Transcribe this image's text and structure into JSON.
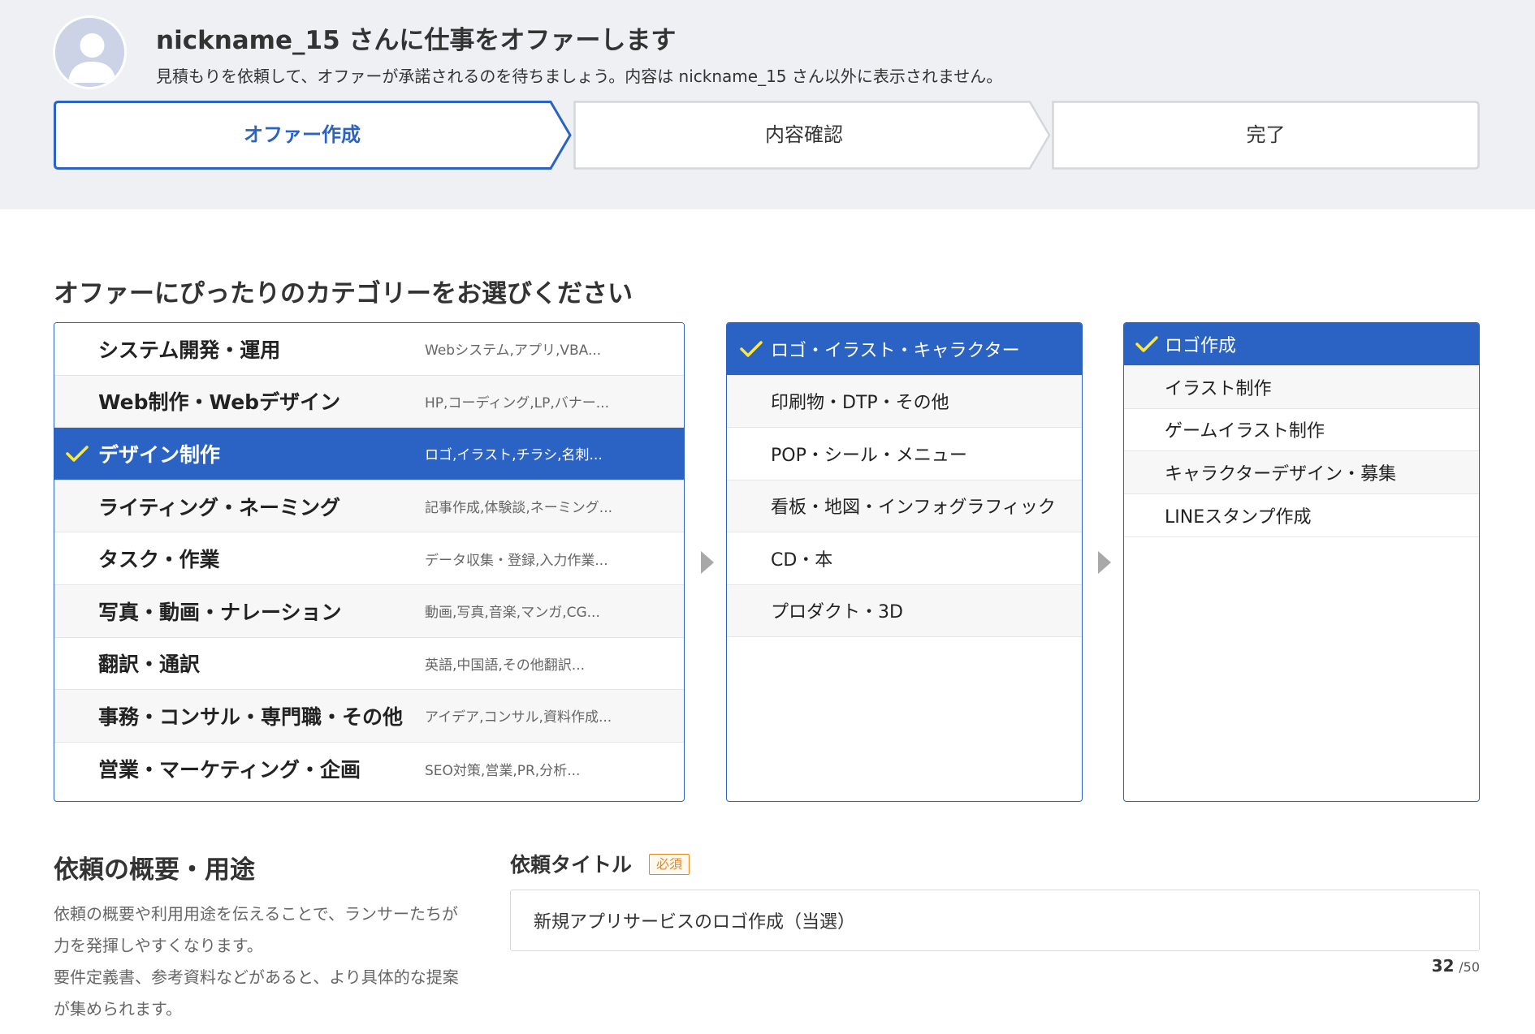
{
  "header": {
    "title": "nickname_15 さんに仕事をオファーします",
    "subtitle": "見積もりを依頼して、オファーが承諾されるのを待ちましょう。内容は nickname_15 さん以外に表示されません。",
    "steps": [
      {
        "label": "オファー作成",
        "active": true
      },
      {
        "label": "内容確認",
        "active": false
      },
      {
        "label": "完了",
        "active": false
      }
    ]
  },
  "category": {
    "heading": "オファーにぴったりのカテゴリーをお選びください",
    "main": [
      {
        "label": "システム開発・運用",
        "desc": "Webシステム,アプリ,VBA..."
      },
      {
        "label": "Web制作・Webデザイン",
        "desc": "HP,コーディング,LP,バナー..."
      },
      {
        "label": "デザイン制作",
        "desc": "ロゴ,イラスト,チラシ,名刺..."
      },
      {
        "label": "ライティング・ネーミング",
        "desc": "記事作成,体験談,ネーミング..."
      },
      {
        "label": "タスク・作業",
        "desc": "データ収集・登録,入力作業..."
      },
      {
        "label": "写真・動画・ナレーション",
        "desc": "動画,写真,音楽,マンガ,CG..."
      },
      {
        "label": "翻訳・通訳",
        "desc": "英語,中国語,その他翻訳..."
      },
      {
        "label": "事務・コンサル・専門職・その他",
        "desc": "アイデア,コンサル,資料作成..."
      },
      {
        "label": "営業・マーケティング・企画",
        "desc": "SEO対策,営業,PR,分析..."
      }
    ],
    "sub": [
      {
        "label": "ロゴ・イラスト・キャラクター"
      },
      {
        "label": "印刷物・DTP・その他"
      },
      {
        "label": "POP・シール・メニュー"
      },
      {
        "label": "看板・地図・インフォグラフィック"
      },
      {
        "label": "CD・本"
      },
      {
        "label": "プロダクト・3D"
      }
    ],
    "detail": [
      {
        "label": "ロゴ作成"
      },
      {
        "label": "イラスト制作"
      },
      {
        "label": "ゲームイラスト制作"
      },
      {
        "label": "キャラクターデザイン・募集"
      },
      {
        "label": "LINEスタンプ作成"
      }
    ]
  },
  "overview": {
    "heading": "依頼の概要・用途",
    "desc1": "依頼の概要や利用用途を伝えることで、ランサーたちが力を発揮しやすくなります。",
    "desc2": "要件定義書、参考資料などがあると、より具体的な提案が集められます。"
  },
  "request_title": {
    "label": "依頼タイトル",
    "required_badge": "必須",
    "value": "新規アプリサービスのロゴ作成（当選）",
    "count": "32",
    "max": "/50"
  },
  "colors": {
    "accent": "#2b63c4",
    "required": "#e08a1f",
    "header_bg": "#eef0f4"
  }
}
